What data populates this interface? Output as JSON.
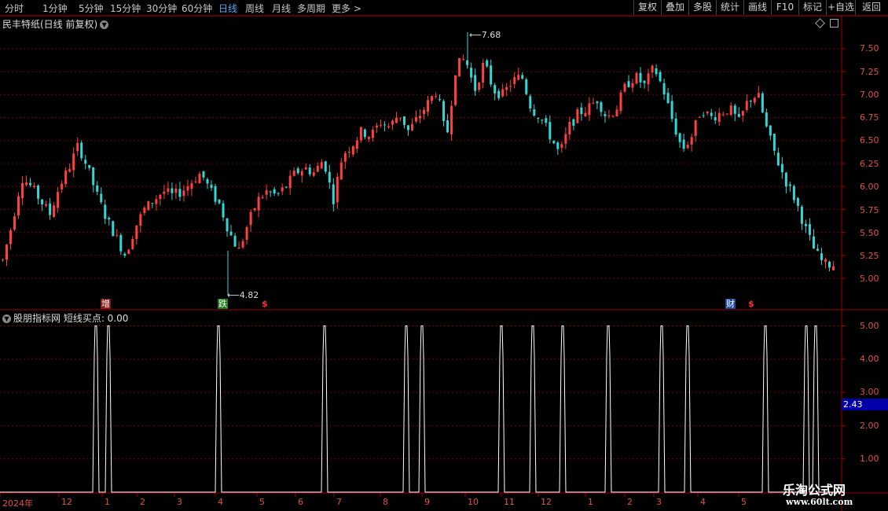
{
  "toolbar": {
    "periods": [
      "分时",
      "1分钟",
      "5分钟",
      "15分钟",
      "30分钟",
      "60分钟",
      "日线",
      "周线",
      "月线",
      "多周期",
      "更多 >"
    ],
    "active_period": "日线",
    "buttons": [
      "复权",
      "叠加",
      "多股",
      "统计",
      "画线",
      "F10",
      "标记",
      "+自选",
      "返回"
    ]
  },
  "main_title": "民丰特纸(日线 前复权)",
  "indicator_title": "股朋指标网  短线买点: 0.00",
  "price_axis": [
    "7.50",
    "7.25",
    "7.00",
    "6.75",
    "6.50",
    "6.25",
    "6.00",
    "5.75",
    "5.50",
    "5.25",
    "5.00"
  ],
  "indicator_axis": [
    "5.00",
    "4.00",
    "3.00",
    "2.00",
    "1.00"
  ],
  "indicator_current": "2.43",
  "annotations": {
    "high": "7.68",
    "low": "4.82"
  },
  "markers": [
    {
      "text": "增",
      "kind": "fill-red"
    },
    {
      "text": "跌",
      "kind": "fill-green"
    },
    {
      "text": "$",
      "kind": "dollar"
    },
    {
      "text": "财",
      "kind": "fill-blue"
    },
    {
      "text": "$",
      "kind": "dollar"
    }
  ],
  "x_axis": [
    "2024年",
    "12",
    "1",
    "2",
    "3",
    "4",
    "5",
    "6",
    "7",
    "8",
    "9",
    "10",
    "11",
    "12",
    "1",
    "2",
    "3",
    "4",
    "5"
  ],
  "watermark": {
    "line1": "乐淘公式网",
    "line2": "www.60lt.com"
  },
  "colors": {
    "up": "#ff4040",
    "down": "#30d8d8",
    "grid": "#7a0000",
    "axis_text": "#e05050",
    "active": "#4fa9ff"
  },
  "chart_data": [
    {
      "type": "candlestick",
      "title": "民丰特纸(日线 前复权)",
      "ylim": [
        4.75,
        7.75
      ],
      "annotations": [
        {
          "label": "7.68",
          "kind": "period-high"
        },
        {
          "label": "4.82",
          "kind": "period-low"
        }
      ],
      "close_trend": [
        5.2,
        5.6,
        6.1,
        6.0,
        5.85,
        5.7,
        6.0,
        6.2,
        6.45,
        6.2,
        5.9,
        5.65,
        5.45,
        5.25,
        5.55,
        5.75,
        5.85,
        5.95,
        5.9,
        5.95,
        6.05,
        6.15,
        5.95,
        5.8,
        5.5,
        5.3,
        5.6,
        5.85,
        5.95,
        5.9,
        6.0,
        6.15,
        6.2,
        6.15,
        6.3,
        5.85,
        6.35,
        6.45,
        6.6,
        6.55,
        6.7,
        6.65,
        6.8,
        6.6,
        6.75,
        6.9,
        7.05,
        6.5,
        7.3,
        7.4,
        7.05,
        7.35,
        7.05,
        7.0,
        7.15,
        7.2,
        6.85,
        6.75,
        6.55,
        6.35,
        6.65,
        6.8,
        6.85,
        6.95,
        6.75,
        6.85,
        7.1,
        7.2,
        7.1,
        7.3,
        7.05,
        6.7,
        6.4,
        6.55,
        6.85,
        6.75,
        6.8,
        6.85,
        6.7,
        6.95,
        7.0,
        6.6,
        6.3,
        6.05,
        5.85,
        5.55,
        5.3,
        5.15,
        5.15
      ]
    },
    {
      "type": "line",
      "title": "股朋指标网  短线买点",
      "ylim": [
        0,
        5.2
      ],
      "series": [
        {
          "name": "短线买点",
          "spike_peak": 5,
          "spike_count": 16,
          "last_value": 0.0
        }
      ]
    }
  ]
}
